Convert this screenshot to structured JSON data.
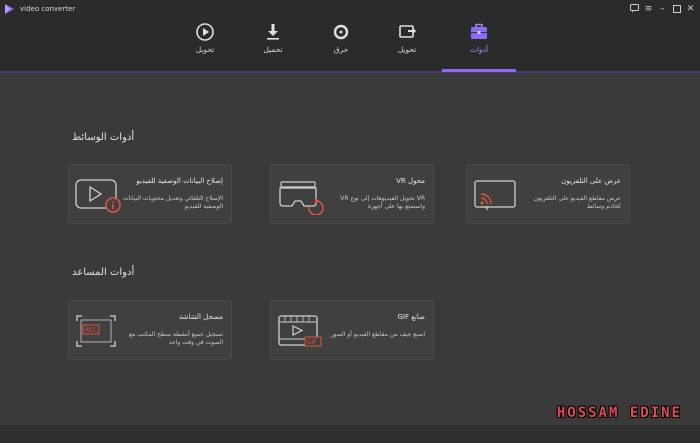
{
  "window": {
    "title": "video converter"
  },
  "nav": {
    "items": [
      {
        "label": "تحويل",
        "icon": "play-circle-icon"
      },
      {
        "label": "تحميل",
        "icon": "download-icon"
      },
      {
        "label": "حرق",
        "icon": "burn-disc-icon"
      },
      {
        "label": "تحويل",
        "icon": "transfer-icon"
      },
      {
        "label": "أدوات",
        "icon": "toolbox-icon"
      }
    ],
    "active_index": 4
  },
  "sections": {
    "media": {
      "title": "أدوات الوسائط",
      "cards": [
        {
          "title": "إصلاح البيانات الوصفية للفيديو",
          "desc": "الإصلاح التلقائي وتعديل محتويات البيانات الوصفية للفيديو",
          "icon": "video-info-icon"
        },
        {
          "title": "محول VR",
          "desc": "VR تحويل الفيديوهات إلى نوع VR واستمتع بها على أجهزة",
          "icon": "vr-headset-icon"
        },
        {
          "title": "عرض على التلفزيون",
          "desc": "عرض مقاطع الفيديو على التلفزيون كخادم وسائط",
          "icon": "cast-tv-icon"
        }
      ]
    },
    "helper": {
      "title": "أدوات المساعد",
      "cards": [
        {
          "title": "مسجل الشاشة",
          "desc": "تسجيل جميع أنشطة سطح المكتب مع الصوت في وقت واحد",
          "icon": "screen-recorder-icon",
          "badge": "REC"
        },
        {
          "title": "صانع GIF",
          "desc": "اصنع جيف من مقاطع الفيديو أو الصور",
          "icon": "gif-maker-icon",
          "badge": "GIF"
        }
      ]
    }
  },
  "watermark": "HOSSAM EDINE",
  "colors": {
    "accent": "#8c6cf5",
    "rec_red": "#e5533d",
    "bg": "#3a3a3a",
    "nav_bg": "#2b2b2b"
  }
}
